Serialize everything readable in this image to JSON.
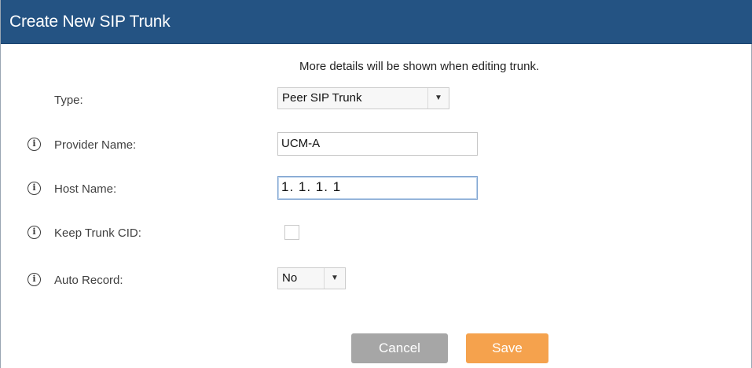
{
  "dialog": {
    "title": "Create New SIP Trunk",
    "notice": "More details will be shown when editing trunk."
  },
  "form": {
    "type": {
      "label": "Type:",
      "value": "Peer SIP Trunk"
    },
    "provider_name": {
      "label": "Provider Name:",
      "value": "UCM-A"
    },
    "host_name": {
      "label": "Host Name:",
      "value": "1. 1. 1. 1"
    },
    "keep_trunk_cid": {
      "label": "Keep Trunk CID:",
      "checked": false
    },
    "auto_record": {
      "label": "Auto Record:",
      "value": "No"
    }
  },
  "icons": {
    "info": "i",
    "dropdown": "▼"
  },
  "buttons": {
    "cancel": "Cancel",
    "save": "Save"
  },
  "colors": {
    "titlebar": "#245383",
    "save_button": "#f5a24d",
    "cancel_button": "#a6a6a6"
  }
}
